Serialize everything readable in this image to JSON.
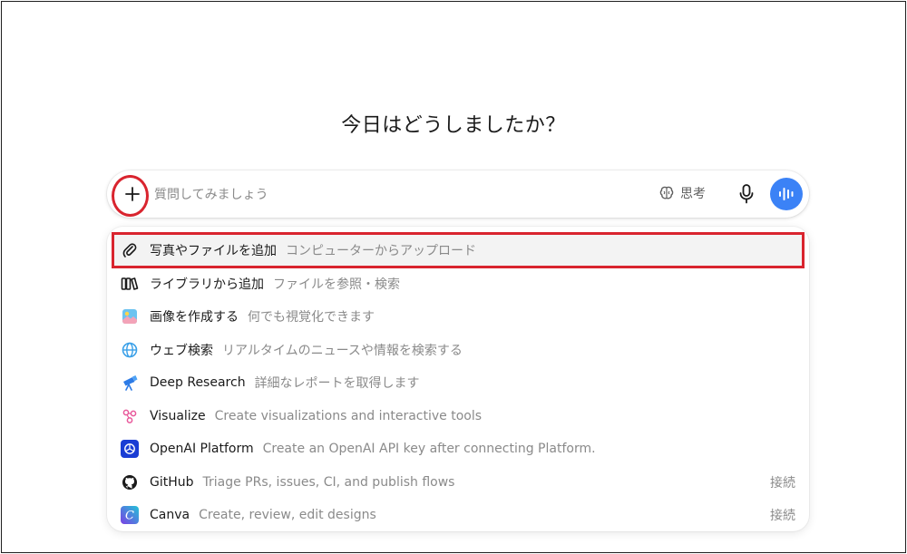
{
  "header": {
    "title": "今日はどうしましたか？"
  },
  "composer": {
    "placeholder": "質問してみましょう",
    "think_label": "思考"
  },
  "menu": {
    "items": [
      {
        "label": "写真やファイルを追加",
        "desc": "コンピューターからアップロード",
        "icon": "paperclip-icon",
        "connect": ""
      },
      {
        "label": "ライブラリから追加",
        "desc": "ファイルを参照・検索",
        "icon": "library-icon",
        "connect": ""
      },
      {
        "label": "画像を作成する",
        "desc": "何でも視覚化できます",
        "icon": "image-create-icon",
        "connect": ""
      },
      {
        "label": "ウェブ検索",
        "desc": "リアルタイムのニュースや情報を検索する",
        "icon": "globe-icon",
        "connect": ""
      },
      {
        "label": "Deep Research",
        "desc": "詳細なレポートを取得します",
        "icon": "telescope-icon",
        "connect": ""
      },
      {
        "label": "Visualize",
        "desc": "Create visualizations and interactive tools",
        "icon": "visualize-icon",
        "connect": ""
      },
      {
        "label": "OpenAI Platform",
        "desc": "Create an OpenAI API key after connecting Platform.",
        "icon": "openai-icon",
        "connect": ""
      },
      {
        "label": "GitHub",
        "desc": "Triage PRs, issues, CI, and publish flows",
        "icon": "github-icon",
        "connect": "接続"
      },
      {
        "label": "Canva",
        "desc": "Create, review, edit designs",
        "icon": "canva-icon",
        "connect": "接続"
      }
    ]
  },
  "colors": {
    "accent_blue": "#3b82f6",
    "highlight_red": "#d9242e",
    "text_primary": "#1a1a1a",
    "text_secondary": "#8a8a8a"
  }
}
